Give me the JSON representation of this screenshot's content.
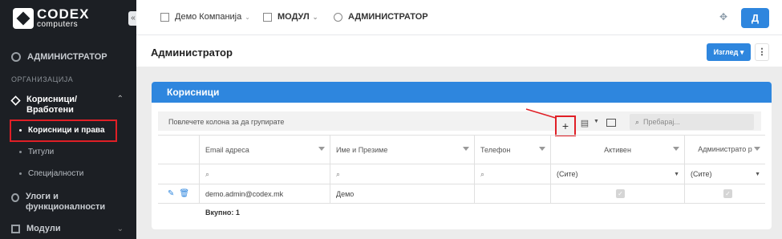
{
  "brand": {
    "name": "CODEX",
    "sub": "computers"
  },
  "sidebar": {
    "collapse": "«",
    "admin": "АДМИНИСТРАТОР",
    "section": "ОРГАНИЗАЦИЈА",
    "group": {
      "label": "Корисници/ Вработени",
      "chevron": "⌃"
    },
    "items": [
      {
        "label": "Корисници и права",
        "active": true
      },
      {
        "label": "Титули"
      },
      {
        "label": "Специјалности"
      }
    ],
    "roles": "Улоги и функционалности",
    "modules": {
      "label": "Модули",
      "chevron": "⌄"
    }
  },
  "topbar": {
    "company": "Демо Компанија",
    "module": "МОДУЛ",
    "admin": "АДМИНИСТРАТОР",
    "avatar": "Д",
    "caret": "⌄"
  },
  "page": {
    "title": "Администратор",
    "view_button": "Изглед",
    "more": "⋮"
  },
  "card": {
    "title": "Корисници",
    "group_hint": "Повлечете колона за да групирате",
    "add": "+",
    "search_placeholder": "Пребарај...",
    "columns": [
      "Email адреса",
      "Име и Презиме",
      "Телефон",
      "Активен",
      "Администрато р"
    ],
    "filters": {
      "active": "(Сите)",
      "admin": "(Сите)"
    },
    "rows": [
      {
        "email": "demo.admin@codex.mk",
        "name": "Демо",
        "phone": "",
        "active": true,
        "admin": true
      }
    ],
    "total": "Вкупно: 1"
  },
  "colors": {
    "accent": "#2e86de",
    "highlight": "#e01f26",
    "sidebar": "#1c1f24"
  }
}
